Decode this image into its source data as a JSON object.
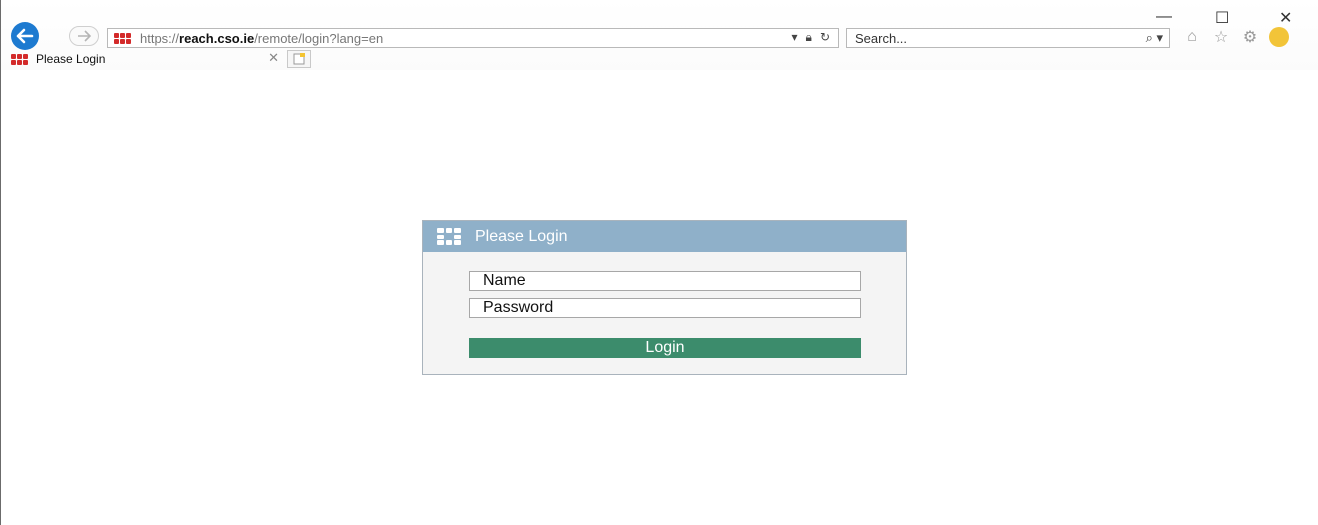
{
  "browser": {
    "url_prefix": "https://",
    "url_host": "reach.cso.ie",
    "url_path": "/remote/login?lang=en",
    "search_placeholder": "Search...",
    "tab_title": "Please Login"
  },
  "login": {
    "title": "Please Login",
    "name_placeholder": "Name",
    "password_placeholder": "Password",
    "button_label": "Login"
  },
  "colors": {
    "panel_header": "#8fb0c9",
    "login_button": "#3c8c6c",
    "back_button": "#1d7ad0",
    "brand_red": "#d32a2a"
  },
  "icons": [
    "back-arrow-icon",
    "forward-arrow-icon",
    "fortinet-logo-icon",
    "dropdown-icon",
    "lock-icon",
    "refresh-icon",
    "search-icon",
    "home-icon",
    "star-icon",
    "gear-icon",
    "smiley-icon",
    "minimize-icon",
    "maximize-icon",
    "close-icon",
    "new-tab-icon"
  ]
}
